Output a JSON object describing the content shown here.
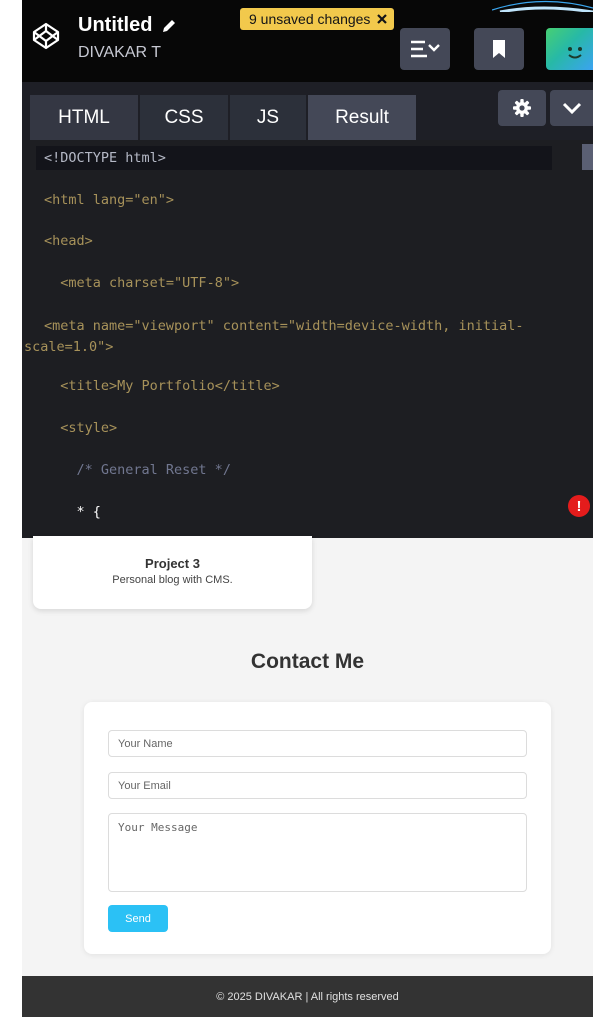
{
  "header": {
    "title": "Untitled",
    "author": "DIVAKAR T",
    "unsaved_text": "9 unsaved changes"
  },
  "tabs": [
    {
      "label": "HTML"
    },
    {
      "label": "CSS"
    },
    {
      "label": "JS"
    },
    {
      "label": "Result"
    }
  ],
  "editor": {
    "lines": [
      "<!DOCTYPE html>",
      "<html lang=\"en\">",
      "<head>",
      "<meta charset=\"UTF-8\">",
      "<meta name=\"viewport\" content=\"width=device-width, initial-scale=1.0\">",
      "<title>My Portfolio</title>",
      "<style>",
      "/* General Reset */",
      "* {"
    ]
  },
  "preview": {
    "project": {
      "title": "Project 3",
      "description": "Personal blog with CMS."
    },
    "contact": {
      "heading": "Contact Me",
      "name_placeholder": "Your Name",
      "email_placeholder": "Your Email",
      "message_placeholder": "Your Message",
      "send_label": "Send"
    },
    "footer_text": "© 2025 DIVAKAR | All rights reserved"
  },
  "colors": {
    "accent_badge": "#f2c94c",
    "send_button": "#2bc1f5",
    "alert": "#e41c1c"
  },
  "icons": [
    "codepen-logo-icon",
    "pencil-icon",
    "close-icon",
    "layout-icon",
    "bookmark-icon",
    "avatar-icon",
    "gear-icon",
    "chevron-down-icon",
    "error-icon"
  ]
}
